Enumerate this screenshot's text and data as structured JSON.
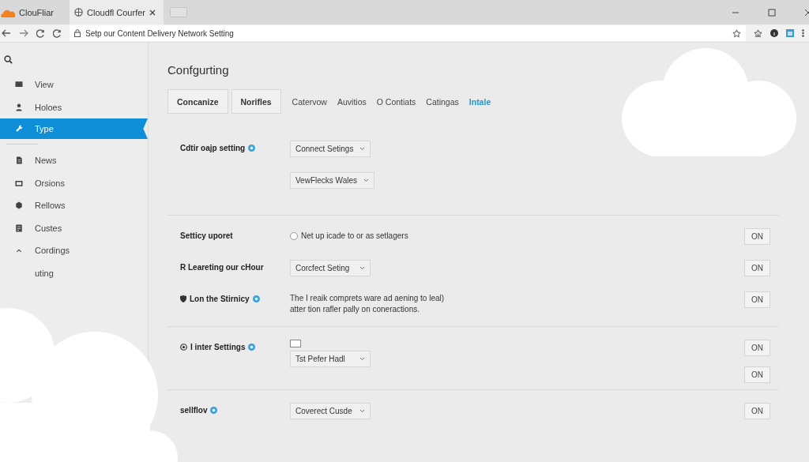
{
  "browser": {
    "tabs": [
      {
        "title": "ClouFliar",
        "selected": false
      },
      {
        "title": "Cloudfl Courfer",
        "selected": true
      }
    ],
    "address": "Setp our Content Delivery Network Setting"
  },
  "sidebar": {
    "items": [
      {
        "label": "View",
        "selected": false
      },
      {
        "label": "Holoes",
        "selected": false
      },
      {
        "label": "Type",
        "selected": true
      },
      {
        "label": "News",
        "selected": false
      },
      {
        "label": "Orsions",
        "selected": false
      },
      {
        "label": "Rellows",
        "selected": false
      },
      {
        "label": "Custes",
        "selected": false
      },
      {
        "label": "Cordings",
        "selected": false
      },
      {
        "label": "uting",
        "selected": false
      }
    ]
  },
  "page": {
    "title": "Confgurting",
    "tabs": [
      {
        "label": "Concanize",
        "kind": "boxed",
        "selected": false
      },
      {
        "label": "Norifles",
        "kind": "boxed",
        "selected": false
      },
      {
        "label": "Catervow",
        "kind": "plain",
        "selected": false
      },
      {
        "label": "Auvitios",
        "kind": "plain",
        "selected": false
      },
      {
        "label": "O Contiats",
        "kind": "plain",
        "selected": false
      },
      {
        "label": "Catingas",
        "kind": "plain",
        "selected": false
      },
      {
        "label": "Intale",
        "kind": "plain",
        "selected": true
      }
    ]
  },
  "sections": [
    {
      "rows": [
        {
          "label": "Cdtir oajp setting",
          "kind": "plain",
          "info": true,
          "controls": [
            {
              "kind": "select",
              "value": "Connect Setings"
            }
          ]
        },
        {
          "kind": "plain",
          "controls": [
            {
              "kind": "select",
              "value": "VewFlecks Wales"
            }
          ]
        }
      ]
    },
    {
      "rows": [
        {
          "label": "Setticy uporet",
          "kind": "plain",
          "info": false,
          "controls": [
            {
              "kind": "radio",
              "label": "Net up icade to or as setlagers",
              "checked": false
            }
          ],
          "toggles": [
            "ON"
          ]
        },
        {
          "label": "R Leareting our cHour",
          "kind": "plain",
          "info": false,
          "controls": [
            {
              "kind": "select",
              "value": "Corcfect Seting"
            }
          ],
          "toggles": [
            "ON"
          ]
        },
        {
          "label": "Lon the Stirnicy",
          "kind": "shield",
          "info": true,
          "controls": [
            {
              "kind": "text",
              "text": "The I reaik comprets ware ad aening to leal) atter tion rafler pally on coneractions."
            }
          ],
          "toggles": [
            "ON"
          ]
        }
      ]
    },
    {
      "rows": [
        {
          "label": "I inter Settings",
          "kind": "target",
          "info": true,
          "controls": [
            {
              "kind": "checkbox",
              "checked": false
            },
            {
              "kind": "select",
              "value": "Tst Pefer Hadl"
            }
          ],
          "toggles": [
            "ON",
            "ON"
          ]
        }
      ]
    },
    {
      "rows": [
        {
          "label": "sellflov",
          "kind": "plain",
          "info": true,
          "controls": [
            {
              "kind": "select",
              "value": "Coverect Cusde"
            }
          ],
          "toggles": [
            "ON"
          ]
        }
      ]
    }
  ]
}
